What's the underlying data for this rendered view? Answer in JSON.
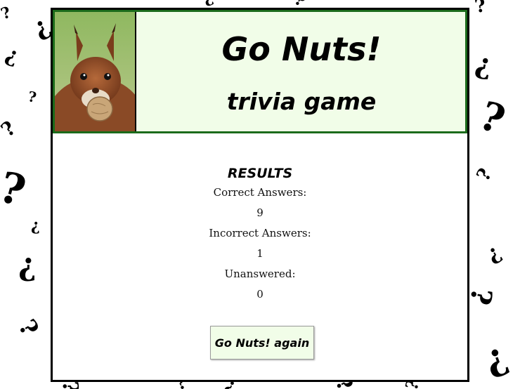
{
  "header": {
    "title": "Go Nuts!",
    "subtitle": "trivia game",
    "image_icon": "squirrel-holding-nut-photo"
  },
  "results": {
    "heading": "RESULTS",
    "correct_label": "Correct Answers:",
    "correct_value": "9",
    "incorrect_label": "Incorrect Answers:",
    "incorrect_value": "1",
    "unanswered_label": "Unanswered:",
    "unanswered_value": "0"
  },
  "again_button": {
    "label": "Go Nuts! again"
  },
  "background": {
    "mark_glyphs": [
      "?",
      "¿"
    ],
    "icon": "question-mark-pattern"
  },
  "colors": {
    "header_bg": "#f1fde8",
    "header_border": "#1b6b1b",
    "panel_border": "#000000"
  }
}
